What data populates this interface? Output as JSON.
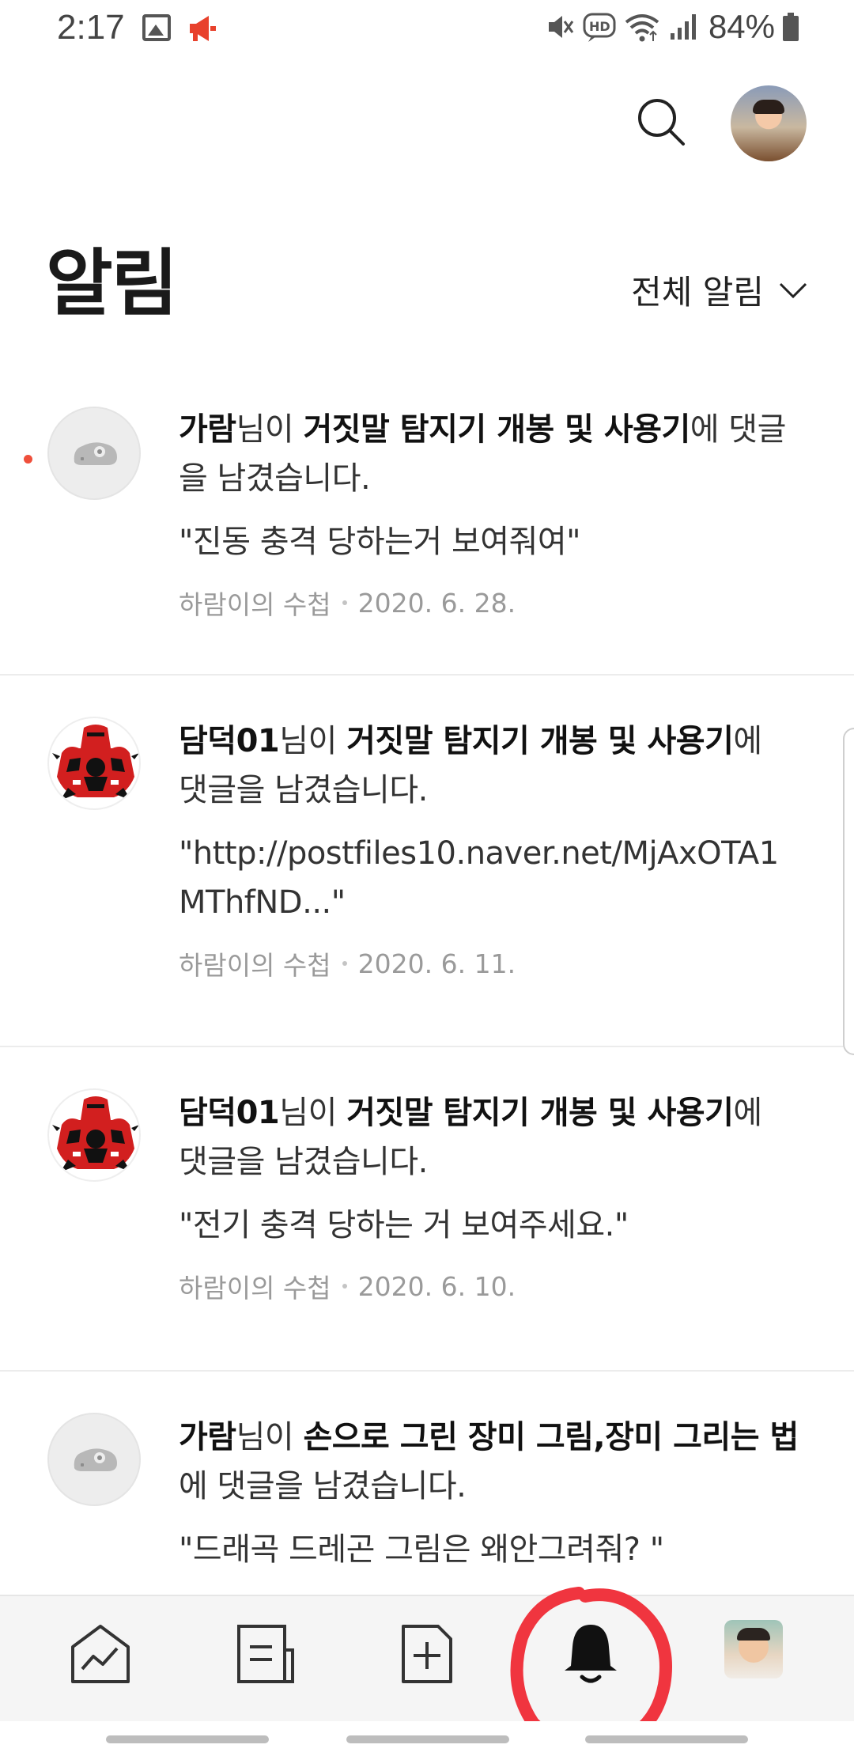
{
  "status_bar": {
    "time": "2:17",
    "battery": "84%",
    "icons": [
      "image-icon",
      "megaphone-icon",
      "mute-icon",
      "hd-icon",
      "wifi-icon",
      "signal-icon",
      "battery-icon"
    ],
    "megaphone_color": "#e8412c"
  },
  "header": {
    "search_icon": "search-icon",
    "avatar": "profile-avatar"
  },
  "page": {
    "title": "알림",
    "filter_label": "전체 알림"
  },
  "notifications": [
    {
      "user": "가람",
      "suffix_user": "님이 ",
      "post": "거짓말 탐지기 개봉 및 사용기",
      "suffix_post": "에 댓글을 남겼습니다.",
      "comment": "\"진동 충격 당하는거 보여줘여\"",
      "blog": "하람이의 수첩",
      "date": "2020. 6. 28.",
      "unread": true,
      "avatar": "default-avatar"
    },
    {
      "user": "담덕01",
      "suffix_user": "님이 ",
      "post": "거짓말 탐지기 개봉 및 사용기",
      "suffix_post": "에 댓글을 남겼습니다.",
      "comment": "\"http://postfiles10.naver.net/MjAxOTA1MThfND...\"",
      "blog": "하람이의 수첩",
      "date": "2020. 6. 11.",
      "unread": false,
      "avatar": "red-warrior-avatar"
    },
    {
      "user": "담덕01",
      "suffix_user": "님이 ",
      "post": "거짓말 탐지기 개봉 및 사용기",
      "suffix_post": "에 댓글을 남겼습니다.",
      "comment": "\"전기 충격 당하는 거 보여주세요.\"",
      "blog": "하람이의 수첩",
      "date": "2020. 6. 10.",
      "unread": false,
      "avatar": "red-warrior-avatar"
    },
    {
      "user": "가람",
      "suffix_user": "님이 ",
      "post": "손으로 그린 장미 그림,장미 그리는 법",
      "suffix_post": "에 댓글을 남겼습니다.",
      "comment": "\"드래곡 드레곤 그림은 왜안그려줘? \"",
      "unread": false,
      "avatar": "default-avatar"
    }
  ],
  "bottom_nav": {
    "items": [
      "stats-icon",
      "posts-icon",
      "write-icon",
      "bell-icon",
      "profile-thumbnail"
    ],
    "active": "bell-icon"
  },
  "colors": {
    "unread_dot": "#ef4f3b",
    "annotation_circle": "#f0353f"
  }
}
